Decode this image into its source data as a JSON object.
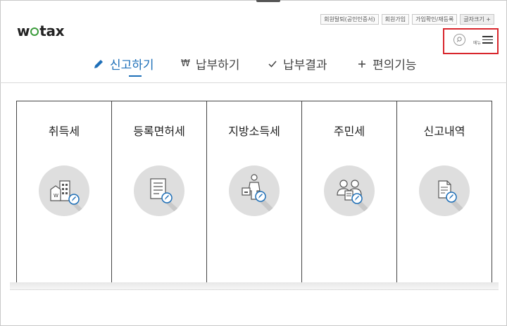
{
  "header": {
    "logo_text": "wetax",
    "utility_links": [
      {
        "label": "회원탈퇴(공인인증서)"
      },
      {
        "label": "회원가입"
      },
      {
        "label": "가입확인/재등록"
      },
      {
        "label": "글자크기 +"
      }
    ],
    "menu_label": "메뉴"
  },
  "nav": {
    "items": [
      {
        "label": "신고하기",
        "icon": "pencil-icon"
      },
      {
        "label": "납부하기",
        "icon": "won-icon"
      },
      {
        "label": "납부결과",
        "icon": "check-icon"
      },
      {
        "label": "편의기능",
        "icon": "plus-icon"
      }
    ],
    "active_index": 0
  },
  "cards": [
    {
      "title": "취득세",
      "icon": "building-icon"
    },
    {
      "title": "등록면허세",
      "icon": "document-icon"
    },
    {
      "title": "지방소득세",
      "icon": "worker-icon"
    },
    {
      "title": "주민세",
      "icon": "people-icon"
    },
    {
      "title": "신고내역",
      "icon": "file-icon"
    }
  ],
  "colors": {
    "accent": "#1d6fb8",
    "logo_green": "#3a9b3a",
    "highlight_red": "#d8262c",
    "icon_circle": "#dedede"
  }
}
